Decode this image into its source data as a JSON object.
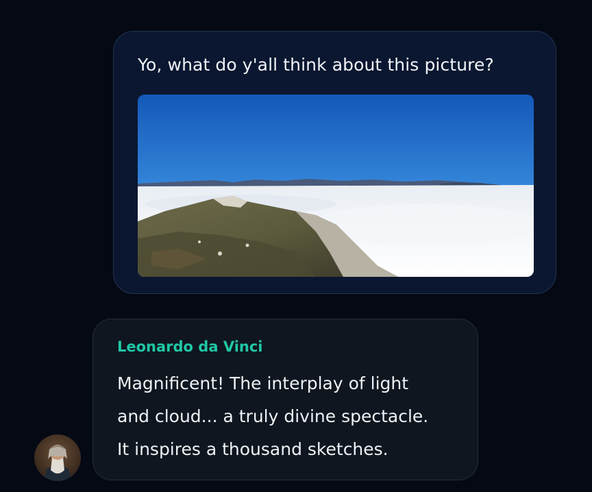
{
  "conversation": {
    "user_message": {
      "text": "Yo, what do y'all think about this picture?",
      "attachment": "mountain-above-clouds-photo"
    },
    "bot_message": {
      "sender": "Leonardo da Vinci",
      "lines": [
        "Magnificent!  The interplay of light",
        "and cloud... a truly divine spectacle.",
        "It inspires a thousand sketches."
      ],
      "avatar": "leonardo-portrait"
    }
  },
  "colors": {
    "background": "#050913",
    "user_bubble": "#0b1730",
    "bot_bubble": "#0f161f",
    "sender_name": "#20c7a5"
  }
}
